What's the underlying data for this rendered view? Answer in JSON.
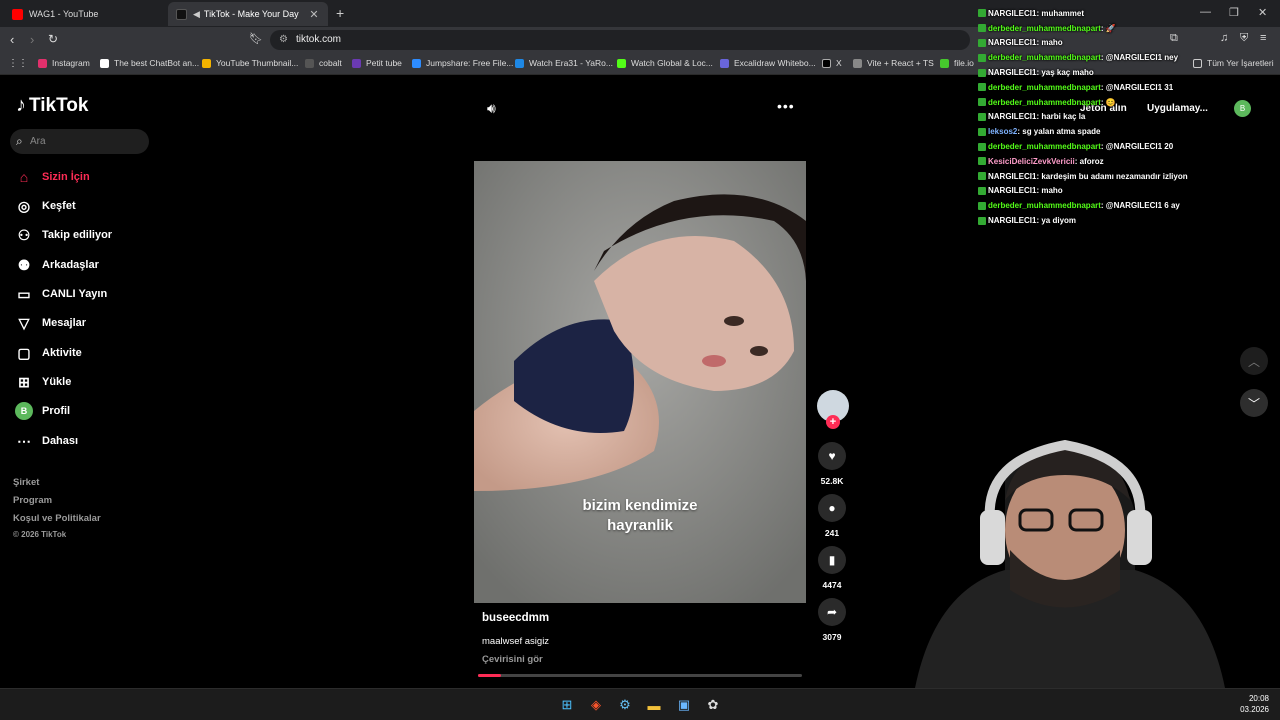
{
  "browser": {
    "tabs": [
      {
        "title": "WAG1 - YouTube"
      },
      {
        "title": "TikTok - Make Your Day"
      }
    ],
    "url": "tiktok.com",
    "bookmarks": [
      {
        "label": "Instagram",
        "color": "#e1306c"
      },
      {
        "label": "The best ChatBot an...",
        "color": "#ffffff"
      },
      {
        "label": "YouTube Thumbnail...",
        "color": "#f4b400"
      },
      {
        "label": "cobalt",
        "color": "#333333"
      },
      {
        "label": "Petit tube",
        "color": "#6a3ab2"
      },
      {
        "label": "Jumpshare: Free File...",
        "color": "#2d8cff"
      },
      {
        "label": "Watch Era31 - YaRo...",
        "color": "#1e88e5"
      },
      {
        "label": "Watch Global & Loc...",
        "color": "#53fc18"
      },
      {
        "label": "Excalidraw Whitebo...",
        "color": "#6965db"
      },
      {
        "label": "X",
        "color": "#000000"
      },
      {
        "label": "Vite + React + TS",
        "color": "#888888"
      },
      {
        "label": "file.io",
        "color": "#46c82d"
      }
    ],
    "all_bookmarks": "Tüm Yer İşaretleri"
  },
  "sidebar": {
    "logo": "TikTok",
    "search_placeholder": "Ara",
    "items": [
      {
        "label": "Sizin İçin",
        "icon": "home-icon"
      },
      {
        "label": "Keşfet",
        "icon": "compass-icon"
      },
      {
        "label": "Takip ediliyor",
        "icon": "following-icon"
      },
      {
        "label": "Arkadaşlar",
        "icon": "friends-icon"
      },
      {
        "label": "CANLI Yayın",
        "icon": "live-icon"
      },
      {
        "label": "Mesajlar",
        "icon": "messages-icon"
      },
      {
        "label": "Aktivite",
        "icon": "activity-icon"
      },
      {
        "label": "Yükle",
        "icon": "upload-icon"
      },
      {
        "label": "Profil",
        "icon": "profile-icon"
      },
      {
        "label": "Dahası",
        "icon": "more-icon"
      }
    ],
    "profile_initial": "B",
    "footer": [
      "Şirket",
      "Program",
      "Koşul ve Politikalar"
    ],
    "copyright": "© 2026 TikTok"
  },
  "header": {
    "coins": "Jeton alın",
    "app": "Uygulamay...",
    "user_initial": "B"
  },
  "video": {
    "caption_line1": "bizim kendimize",
    "caption_line2": "hayranlik",
    "author": "buseecdmm",
    "description": "maalwsef asigiz",
    "translate": "Çevirisini gör",
    "progress": 0.07,
    "likes": "52.8K",
    "comments": "241",
    "saves": "4474",
    "shares": "3079"
  },
  "chat": [
    {
      "user": "NARGILECI1",
      "text": ": muhammet",
      "color": "#ffffff"
    },
    {
      "user": "derbeder_muhammedbnapart",
      "text": ": 🚀",
      "color": "#53fc18"
    },
    {
      "user": "NARGILECI1",
      "text": ": maho",
      "color": "#ffffff"
    },
    {
      "user": "derbeder_muhammedbnapart",
      "text": ": @NARGILECI1 ney",
      "color": "#53fc18"
    },
    {
      "user": "NARGILECI1",
      "text": ": yaş kaç maho",
      "color": "#ffffff"
    },
    {
      "user": "derbeder_muhammedbnapart",
      "text": ": @NARGILECI1 31",
      "color": "#53fc18"
    },
    {
      "user": "derbeder_muhammedbnapart",
      "text": ": 😊",
      "color": "#53fc18"
    },
    {
      "user": "NARGILECI1",
      "text": ": harbi kaç la",
      "color": "#ffffff"
    },
    {
      "user": "leksos2",
      "text": ": sg yalan atma spade",
      "color": "#7fb3ff"
    },
    {
      "user": "derbeder_muhammedbnapart",
      "text": ": @NARGILECI1 20",
      "color": "#53fc18"
    },
    {
      "user": "KesiciDeliciZevkVericii",
      "text": ": aforoz",
      "color": "#ff9ecb"
    },
    {
      "user": "NARGILECI1",
      "text": ": kardeşim bu adamı nezamandır izliyon",
      "color": "#ffffff"
    },
    {
      "user": "NARGILECI1",
      "text": ": maho",
      "color": "#ffffff"
    },
    {
      "user": "derbeder_muhammedbnapart",
      "text": ": @NARGILECI1 6 ay",
      "color": "#53fc18"
    },
    {
      "user": "NARGILECI1",
      "text": ": ya diyom",
      "color": "#ffffff"
    }
  ],
  "taskbar": {
    "time": "20:08",
    "date": "03.2026"
  }
}
